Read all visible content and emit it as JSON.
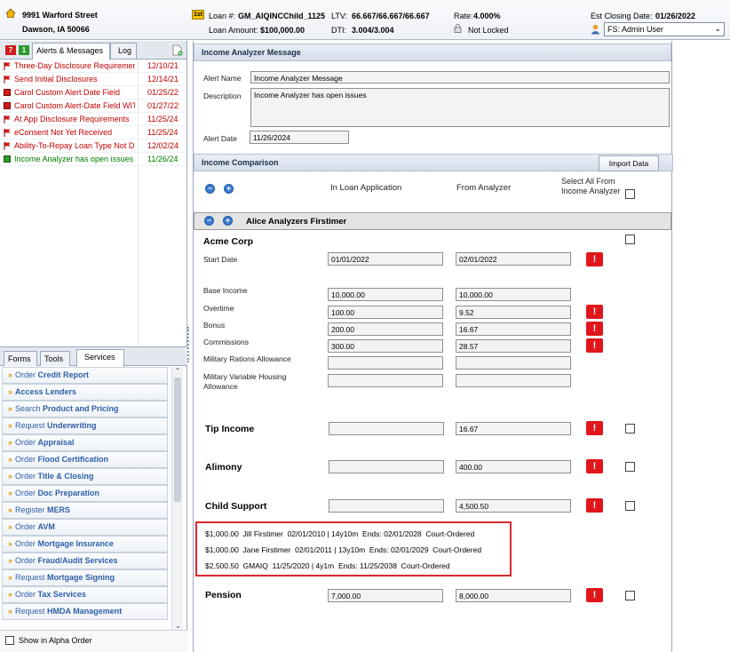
{
  "header": {
    "address1": "9991 Warford Street",
    "address2": "Dawson, IA 50066",
    "lien_badge": "1st",
    "loan_label": "Loan #:",
    "loan_number": "GM_AIQINCChild_1125",
    "ltv_label": "LTV:",
    "ltv_value": "66.667/66.667/66.667",
    "rate_label": "Rate:",
    "rate_value": "4.000%",
    "closing_label": "Est Closing Date:",
    "closing_value": "01/26/2022",
    "amount_label": "Loan Amount:",
    "amount_value": "$100,000.00",
    "dti_label": "DTI:",
    "dti_value": "3.004/3.004",
    "lock_status": "Not Locked",
    "user_select": "FS: Admin User"
  },
  "left": {
    "alert_count_red": "7",
    "alert_count_green": "1",
    "tab_alerts": "Alerts & Messages",
    "tab_log": "Log",
    "alerts": [
      {
        "text": "Three-Day Disclosure Requiremer",
        "date": "12/10/21",
        "color": "red",
        "icon": "flag-icon"
      },
      {
        "text": "Send Initial Disclosures",
        "date": "12/14/21",
        "color": "red",
        "icon": "flag-icon"
      },
      {
        "text": "Carol Custom Alert Date Field",
        "date": "01/25/22",
        "color": "red",
        "icon": "alert-square-icon"
      },
      {
        "text": "Carol Custom Alert-Date Field WIT",
        "date": "01/27/22",
        "color": "red",
        "icon": "alert-square-icon"
      },
      {
        "text": "At App Disclosure Requirements",
        "date": "11/25/24",
        "color": "red",
        "icon": "flag-icon"
      },
      {
        "text": "eConsent Not Yet Received",
        "date": "11/25/24",
        "color": "red",
        "icon": "flag-icon"
      },
      {
        "text": "Ability-To-Repay Loan Type Not D",
        "date": "12/02/24",
        "color": "red",
        "icon": "flag-icon"
      },
      {
        "text": "Income Analyzer has open issues",
        "date": "11/26/24",
        "color": "green",
        "icon": "green-square-icon"
      }
    ],
    "bottom_tabs": [
      "Forms",
      "Tools",
      "Services"
    ],
    "services": [
      {
        "pre": "Order ",
        "bold": "Credit Report"
      },
      {
        "pre": "",
        "bold": "Access Lenders"
      },
      {
        "pre": "Search ",
        "bold": "Product and Pricing"
      },
      {
        "pre": "Request ",
        "bold": "Underwriting"
      },
      {
        "pre": "Order ",
        "bold": "Appraisal"
      },
      {
        "pre": "Order ",
        "bold": "Flood Certification"
      },
      {
        "pre": "Order ",
        "bold": "Title & Closing"
      },
      {
        "pre": "Order ",
        "bold": "Doc Preparation"
      },
      {
        "pre": "Register ",
        "bold": "MERS"
      },
      {
        "pre": "Order ",
        "bold": "AVM"
      },
      {
        "pre": "Order ",
        "bold": "Mortgage Insurance"
      },
      {
        "pre": "Order ",
        "bold": "Fraud/Audit Services"
      },
      {
        "pre": "Request ",
        "bold": "Mortgage Signing"
      },
      {
        "pre": "Order ",
        "bold": "Tax Services"
      },
      {
        "pre": "Request ",
        "bold": "HMDA Management"
      }
    ],
    "alpha_label": "Show in Alpha Order"
  },
  "message": {
    "section_title": "Income Analyzer Message",
    "alert_name_label": "Alert Name",
    "alert_name_value": "Income Analyzer Message",
    "description_label": "Description",
    "description_value": "Income Analyzer has open issues",
    "alert_date_label": "Alert Date",
    "alert_date_value": "11/26/2024"
  },
  "comparison": {
    "section_title": "Income Comparison",
    "import_button": "Import Data",
    "col_loan": "In Loan Application",
    "col_analyzer": "From Analyzer",
    "col_select": "Select All From Income Analyzer",
    "borrower": "Alice Analyzers Firstimer",
    "employer": "Acme Corp",
    "start_date_label": "Start Date",
    "start_date_loan": "01/01/2022",
    "start_date_analyzer": "02/01/2022",
    "rows": [
      {
        "label": "Base Income",
        "loan": "10,000.00",
        "analyzer": "10,000.00",
        "warn": false
      },
      {
        "label": "Overtime",
        "loan": "100.00",
        "analyzer": "9.52",
        "warn": true
      },
      {
        "label": "Bonus",
        "loan": "200.00",
        "analyzer": "16.67",
        "warn": true
      },
      {
        "label": "Commissions",
        "loan": "300.00",
        "analyzer": "28.57",
        "warn": true
      },
      {
        "label": "Military Rations Allowance",
        "loan": "",
        "analyzer": "",
        "warn": false
      },
      {
        "label": "Military Variable Housing Allowance",
        "loan": "",
        "analyzer": "",
        "warn": false
      }
    ],
    "tip_label": "Tip Income",
    "tip_loan": "",
    "tip_analyzer": "16.67",
    "alimony_label": "Alimony",
    "alimony_loan": "",
    "alimony_analyzer": "400.00",
    "child_label": "Child Support",
    "child_loan": "",
    "child_analyzer": "4,500.50",
    "child_details": [
      "$1,000.00  Jill Firstimer  02/01/2010 | 14y10m  Ends: 02/01/2028  Court-Ordered",
      "$1,000.00  Jane Firstimer  02/01/2011 | 13y10m  Ends: 02/01/2029  Court-Ordered",
      "$2,500.50  GMAIQ  11/25/2020 | 4y1m  Ends: 11/25/2038  Court-Ordered"
    ],
    "pension_label": "Pension",
    "pension_loan": "7,000.00",
    "pension_analyzer": "8,000.00"
  }
}
